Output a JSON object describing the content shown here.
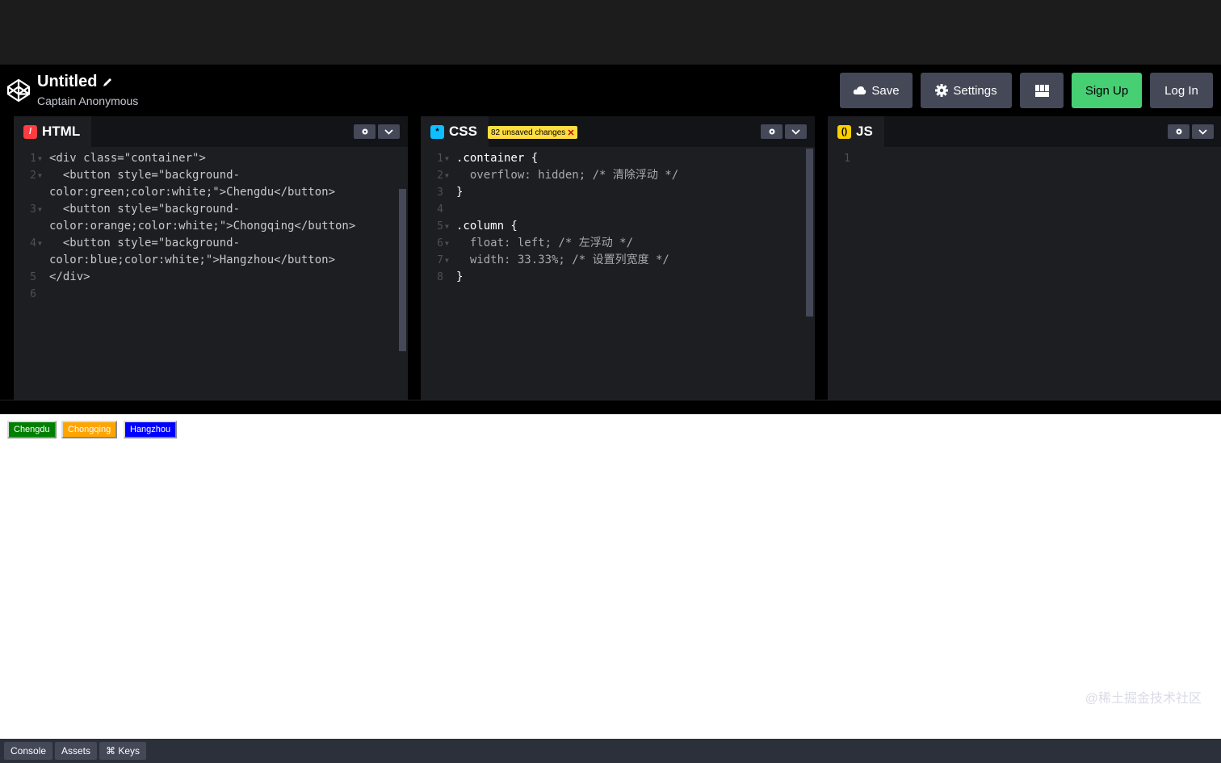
{
  "header": {
    "title": "Untitled",
    "author": "Captain Anonymous",
    "buttons": {
      "save": "Save",
      "settings": "Settings",
      "signup": "Sign Up",
      "login": "Log In"
    }
  },
  "panels": {
    "html": {
      "label": "HTML",
      "lines": [
        "<div class=\"container\">",
        "  <button style=\"background-",
        "color:green;color:white;\">Chengdu</button>",
        "  <button style=\"background-",
        "color:orange;color:white;\">Chongqing</button>",
        "  <button style=\"background-",
        "color:blue;color:white;\">Hangzhou</button>",
        "</div>",
        ""
      ],
      "line_numbers": [
        "1",
        "2",
        "",
        "3",
        "",
        "4",
        "",
        "5",
        "6"
      ]
    },
    "css": {
      "label": "CSS",
      "unsaved": "82 unsaved changes",
      "lines": [
        ".container {",
        "  overflow: hidden; /* 清除浮动 */",
        "}",
        "",
        ".column {",
        "  float: left; /* 左浮动 */",
        "  width: 33.33%; /* 设置列宽度 */",
        "}"
      ],
      "line_numbers": [
        "1",
        "2",
        "3",
        "4",
        "5",
        "6",
        "7",
        "8"
      ]
    },
    "js": {
      "label": "JS",
      "line_numbers": [
        "1"
      ]
    }
  },
  "preview": {
    "buttons": [
      {
        "label": "Chengdu",
        "color": "#008000"
      },
      {
        "label": "Chongqing",
        "color": "#ffa500"
      },
      {
        "label": "Hangzhou",
        "color": "#0000ff"
      }
    ],
    "watermark": "@稀土掘金技术社区"
  },
  "footer": {
    "console": "Console",
    "assets": "Assets",
    "keys": "⌘ Keys"
  },
  "colors": {
    "accent_green": "#47cf73",
    "header_bg": "#000000",
    "panel_bg": "#1d1e22",
    "button_bg": "#444857",
    "unsaved_bg": "#ffdd40"
  }
}
